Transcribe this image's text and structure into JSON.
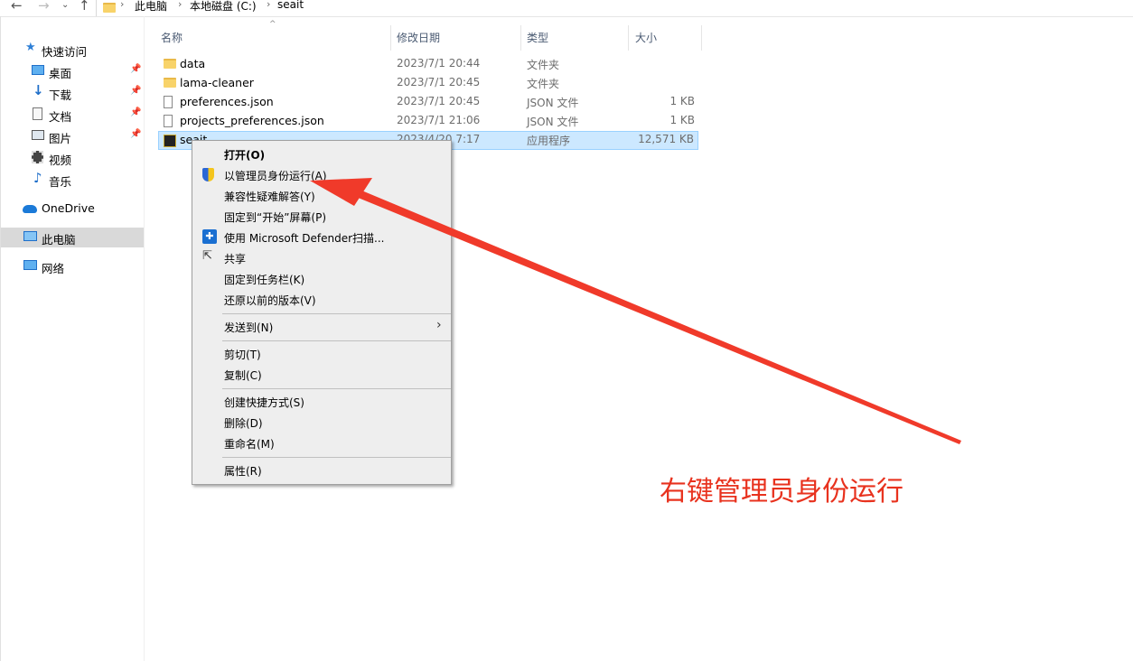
{
  "breadcrumb": {
    "items": [
      "此电脑",
      "本地磁盘 (C:)",
      "seait"
    ]
  },
  "nav": {
    "quick_access": "快速访问",
    "items": [
      {
        "label": "桌面",
        "pinned": true
      },
      {
        "label": "下载",
        "pinned": true
      },
      {
        "label": "文档",
        "pinned": true
      },
      {
        "label": "图片",
        "pinned": true
      },
      {
        "label": "视频",
        "pinned": false
      },
      {
        "label": "音乐",
        "pinned": false
      }
    ],
    "onedrive": "OneDrive",
    "this_pc": "此电脑",
    "network": "网络"
  },
  "columns": {
    "name": "名称",
    "date": "修改日期",
    "type": "类型",
    "size": "大小"
  },
  "files": [
    {
      "name": "data",
      "date": "2023/7/1 20:44",
      "type": "文件夹",
      "size": "",
      "kind": "folder"
    },
    {
      "name": "lama-cleaner",
      "date": "2023/7/1 20:45",
      "type": "文件夹",
      "size": "",
      "kind": "folder"
    },
    {
      "name": "preferences.json",
      "date": "2023/7/1 20:45",
      "type": "JSON 文件",
      "size": "1 KB",
      "kind": "file"
    },
    {
      "name": "projects_preferences.json",
      "date": "2023/7/1 21:06",
      "type": "JSON 文件",
      "size": "1 KB",
      "kind": "file"
    },
    {
      "name": "seait",
      "date": "2023/4/20 7:17",
      "type": "应用程序",
      "size": "12,571 KB",
      "kind": "app",
      "selected": true
    }
  ],
  "context_menu": {
    "open": "打开(O)",
    "run_as_admin": "以管理员身份运行(A)",
    "troubleshoot": "兼容性疑难解答(Y)",
    "pin_start": "固定到“开始”屏幕(P)",
    "defender": "使用 Microsoft Defender扫描...",
    "share": "共享",
    "pin_taskbar": "固定到任务栏(K)",
    "restore": "还原以前的版本(V)",
    "send_to": "发送到(N)",
    "cut": "剪切(T)",
    "copy": "复制(C)",
    "shortcut": "创建快捷方式(S)",
    "delete": "删除(D)",
    "rename": "重命名(M)",
    "properties": "属性(R)"
  },
  "annotation": {
    "text": "右键管理员身份运行",
    "color": "#e8321e"
  },
  "icons": {
    "back": "back-arrow-icon",
    "forward": "forward-arrow-icon",
    "up": "up-arrow-icon",
    "shield": "uac-shield-icon",
    "defender": "defender-icon",
    "share": "share-icon"
  }
}
